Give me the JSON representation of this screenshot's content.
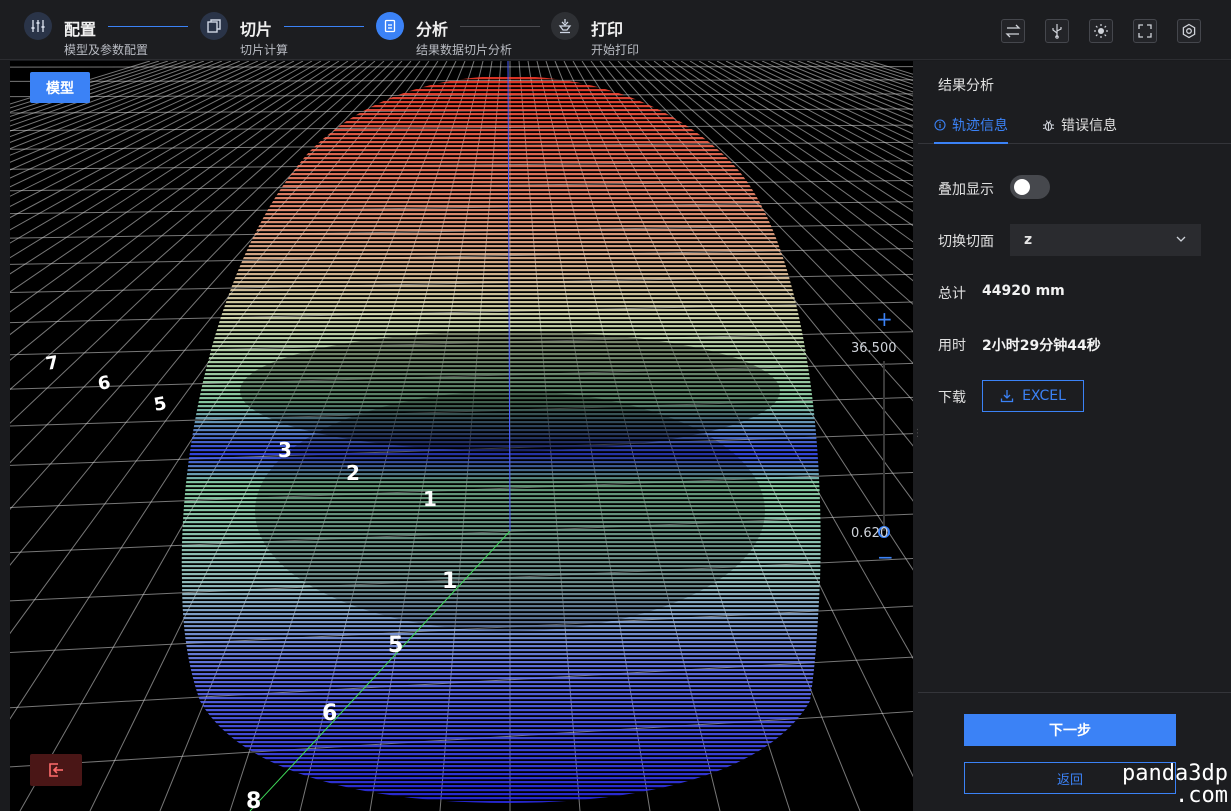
{
  "steps": [
    {
      "title": "配置",
      "sub": "模型及参数配置",
      "icon": "sliders-icon"
    },
    {
      "title": "切片",
      "sub": "切片计算",
      "icon": "layers-icon"
    },
    {
      "title": "分析",
      "sub": "结果数据切片分析",
      "icon": "document-icon"
    },
    {
      "title": "打印",
      "sub": "开始打印",
      "icon": "nozzle-icon"
    }
  ],
  "viewport": {
    "model_label": "模型",
    "slider_max": "36.500",
    "slider_min": "0.620",
    "slider_plus": "+",
    "slider_minus": "−",
    "axis_ticks": [
      "7",
      "6",
      "5",
      "3",
      "2",
      "1",
      "1",
      "5",
      "6",
      "8"
    ]
  },
  "panel": {
    "title": "结果分析",
    "tab_track": "轨迹信息",
    "tab_error": "错误信息",
    "overlay_label": "叠加显示",
    "overlay_on": false,
    "section_label": "切换切面",
    "section_value": "z",
    "total_label": "总计",
    "total_value": "44920 mm",
    "time_label": "用时",
    "time_value": "2小时29分钟44秒",
    "download_label": "下载",
    "excel_label": "EXCEL",
    "next_label": "下一步",
    "back_label": "返回"
  },
  "watermark": {
    "line1": "panda3dp",
    "line2": ".com"
  },
  "colors": {
    "accent": "#3b82f6",
    "bg": "#1a1b1e",
    "exit": "#4a1616"
  }
}
